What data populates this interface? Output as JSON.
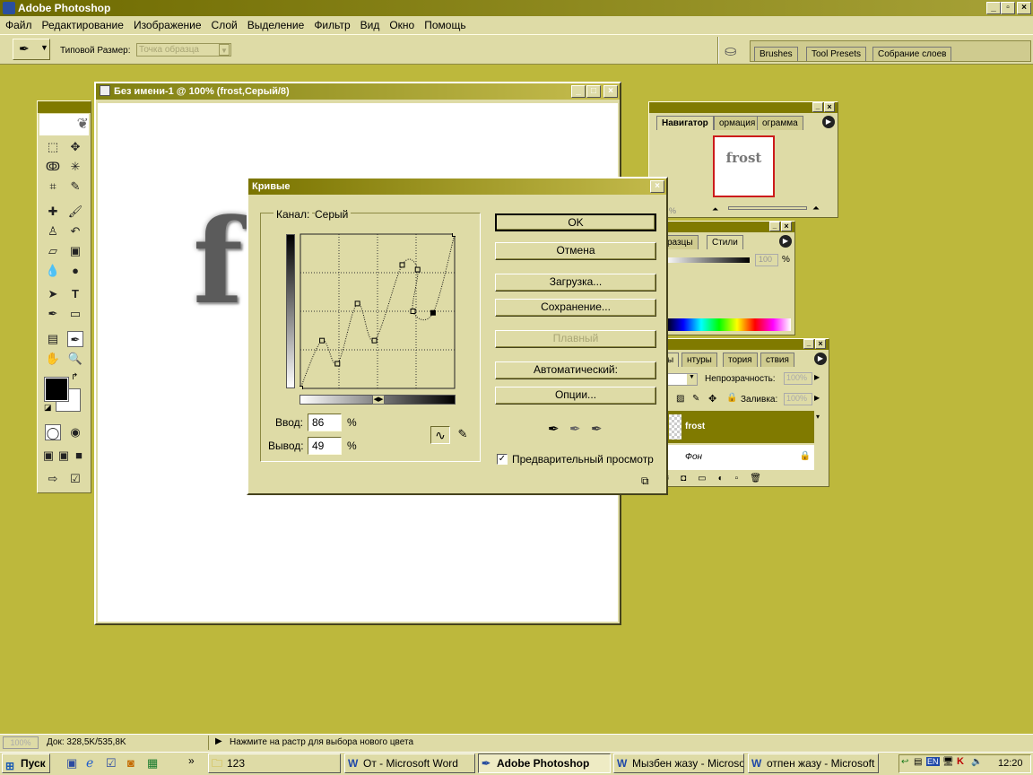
{
  "app": {
    "title": "Adobe Photoshop"
  },
  "menu": [
    "Файл",
    "Редактирование",
    "Изображение",
    "Слой",
    "Выделение",
    "Фильтр",
    "Вид",
    "Окно",
    "Помощь"
  ],
  "options": {
    "size_label": "Типовой Размер:",
    "size_value": "Точка образца"
  },
  "palette_well": {
    "tabs": [
      "Brushes",
      "Tool Presets",
      "Собрание слоев"
    ]
  },
  "document": {
    "title": "Без имени-1 @ 100% (frost,Серый/8)",
    "text": "f"
  },
  "navigator": {
    "tabs": [
      "Навигатор",
      "ормация",
      "ограмма"
    ],
    "thumb_text": "frost",
    "zoom": "%"
  },
  "swatches": {
    "tabs": [
      "разцы",
      "Стили"
    ],
    "value": "100",
    "unit": "%"
  },
  "layers": {
    "tabs": [
      "ы",
      "нтуры",
      "тория",
      "ствия"
    ],
    "opacity_label": "Непрозрачность:",
    "opacity_value": "100%",
    "fill_label": "Заливка:",
    "fill_value": "100%",
    "items": [
      {
        "name": "frost"
      },
      {
        "name": "Фон"
      }
    ]
  },
  "curves": {
    "title": "Кривые",
    "channel_label": "Канал:",
    "channel_value": "Серый",
    "input_label": "Ввод:",
    "input_value": "86",
    "output_label": "Вывод:",
    "output_value": "49",
    "percent": "%",
    "buttons": {
      "ok": "OK",
      "cancel": "Отмена",
      "load": "Загрузка...",
      "save": "Сохранение...",
      "smooth": "Плавный",
      "auto": "Автоматический:",
      "options": "Опции..."
    },
    "preview_label": "Предварительный просмотр",
    "preview_checked": true,
    "points": [
      [
        0,
        0
      ],
      [
        14,
        31
      ],
      [
        24,
        16
      ],
      [
        37,
        55
      ],
      [
        48,
        31
      ],
      [
        66,
        80
      ],
      [
        76,
        77
      ],
      [
        73,
        50
      ],
      [
        86,
        49
      ],
      [
        100,
        100
      ]
    ]
  },
  "status": {
    "zoom": "100%",
    "doc": "Док: 328,5K/535,8K",
    "hint": "Нажмите на растр для выбора нового цвета"
  },
  "taskbar": {
    "start": "Пуск",
    "items": [
      "123",
      "От - Microsoft Word",
      "Adobe Photoshop",
      "Мызбен жазу - Microso...",
      "отпен жазу - Microsoft ..."
    ],
    "lang": "EN",
    "clock": "12:20"
  },
  "colors": {
    "desktop": "#bdb83c",
    "panel": "#dedba6",
    "selected_layer": "#807a00"
  }
}
